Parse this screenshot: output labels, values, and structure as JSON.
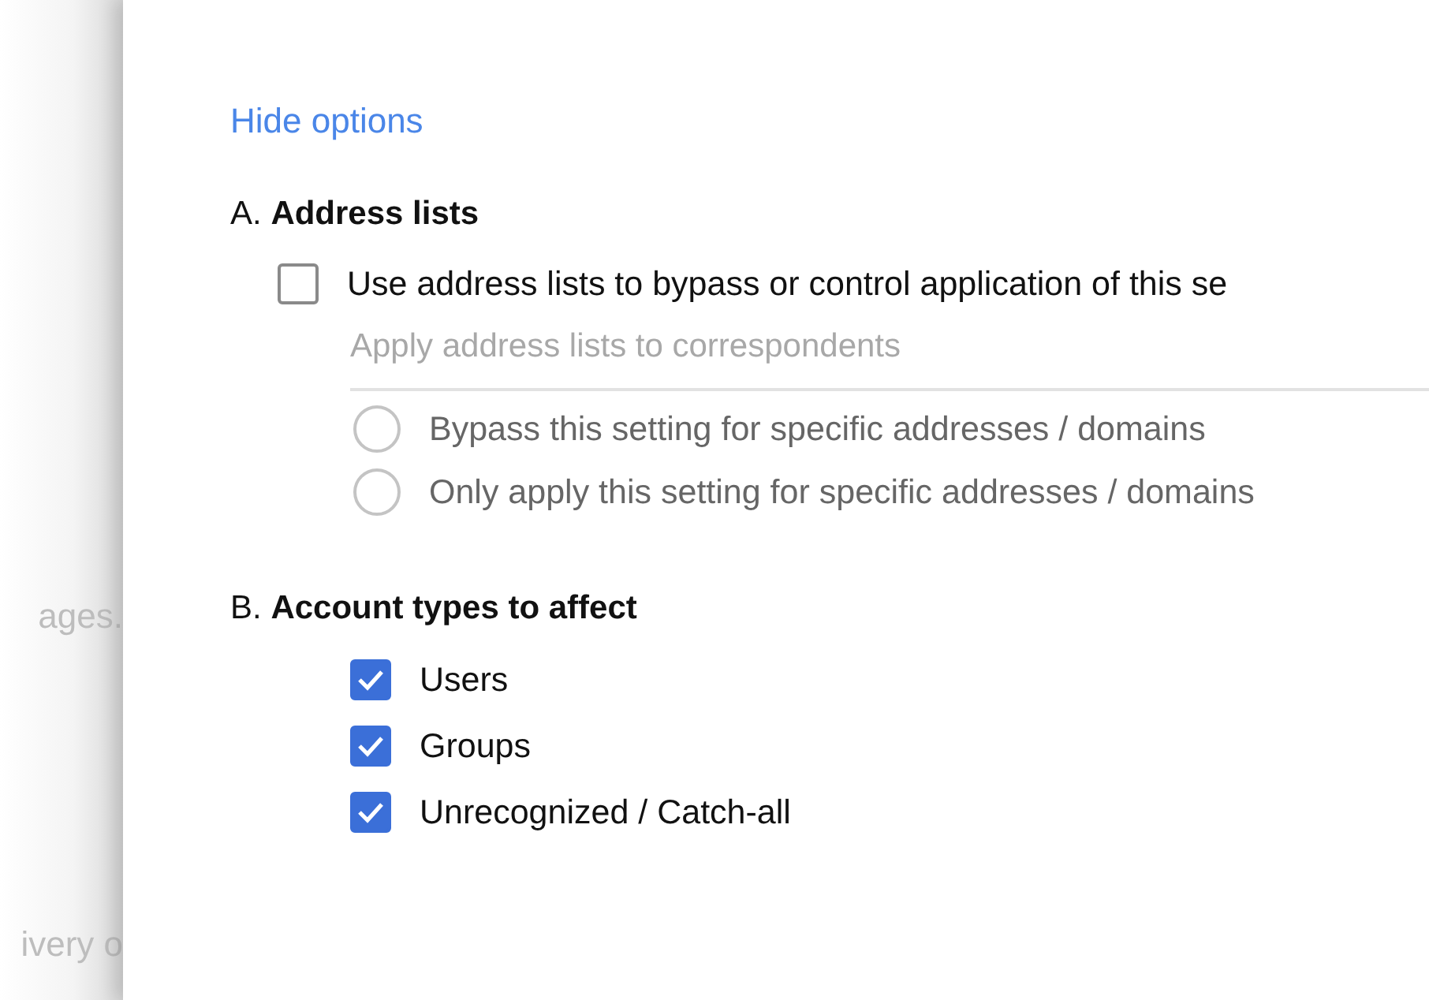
{
  "sidebar_fragments": [
    "ages.",
    "ivery o"
  ],
  "hide_options_link": "Hide options",
  "sections": [
    {
      "kind": "address_lists",
      "heading": "A. **Address lists**",
      "checkbox": {
        "label": "Use address lists to bypass or control application of this se",
        "checked": false
      },
      "subheading": "Apply address lists to correspondents",
      "options": [
        {
          "label": "Bypass this setting for specific addresses / domains",
          "selected": false
        },
        {
          "label": "Only apply this setting for specific addresses / domains",
          "selected": false
        }
      ]
    },
    {
      "kind": "account_types",
      "heading": "B. **Account types to affect**",
      "items": [
        {
          "label": "Users",
          "checked": true
        },
        {
          "label": "Groups",
          "checked": true
        },
        {
          "label": "Unrecognized / Catch-all",
          "checked": true
        }
      ]
    }
  ]
}
